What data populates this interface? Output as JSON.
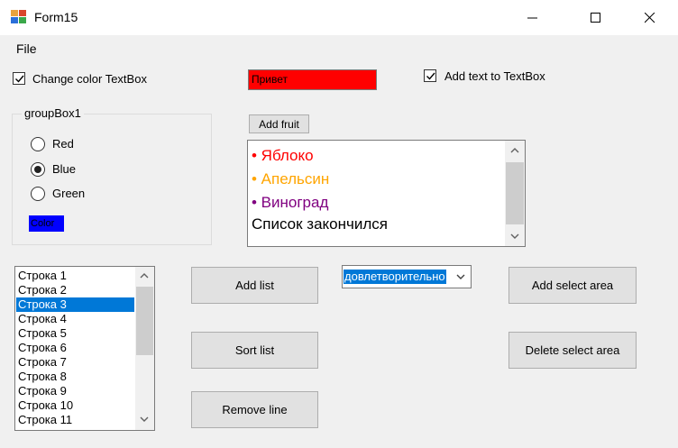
{
  "window": {
    "title": "Form15"
  },
  "menu": {
    "file": "File"
  },
  "checkboxes": {
    "change_color": {
      "label": "Change color TextBox",
      "checked": true
    },
    "add_text": {
      "label": "Add text to TextBox",
      "checked": true
    }
  },
  "textbox": {
    "value": "Привет",
    "background": "#ff0000"
  },
  "groupbox": {
    "title": "groupBox1",
    "radios": [
      {
        "label": "Red",
        "selected": false
      },
      {
        "label": "Blue",
        "selected": true
      },
      {
        "label": "Green",
        "selected": false
      }
    ],
    "color_label": {
      "text": "Color",
      "background": "#0000ff"
    }
  },
  "buttons": {
    "add_fruit": "Add fruit",
    "add_list": "Add list",
    "sort_list": "Sort list",
    "remove_line": "Remove line",
    "add_select_area": "Add select area",
    "delete_select_area": "Delete select area"
  },
  "richtext": {
    "lines": [
      {
        "text": "• Яблоко",
        "color": "#ff0000"
      },
      {
        "text": "• Апельсин",
        "color": "#ffa500"
      },
      {
        "text": "• Виноград",
        "color": "#800080"
      },
      {
        "text": "Список закончился",
        "color": "#000000"
      }
    ]
  },
  "listbox": {
    "items": [
      "Строка 1",
      "Строка 2",
      "Строка 3",
      "Строка 4",
      "Строка 5",
      "Строка 6",
      "Строка 7",
      "Строка 8",
      "Строка 9",
      "Строка 10",
      "Строка 11"
    ],
    "selected_index": 2
  },
  "combo": {
    "value": "довлетворительно"
  }
}
